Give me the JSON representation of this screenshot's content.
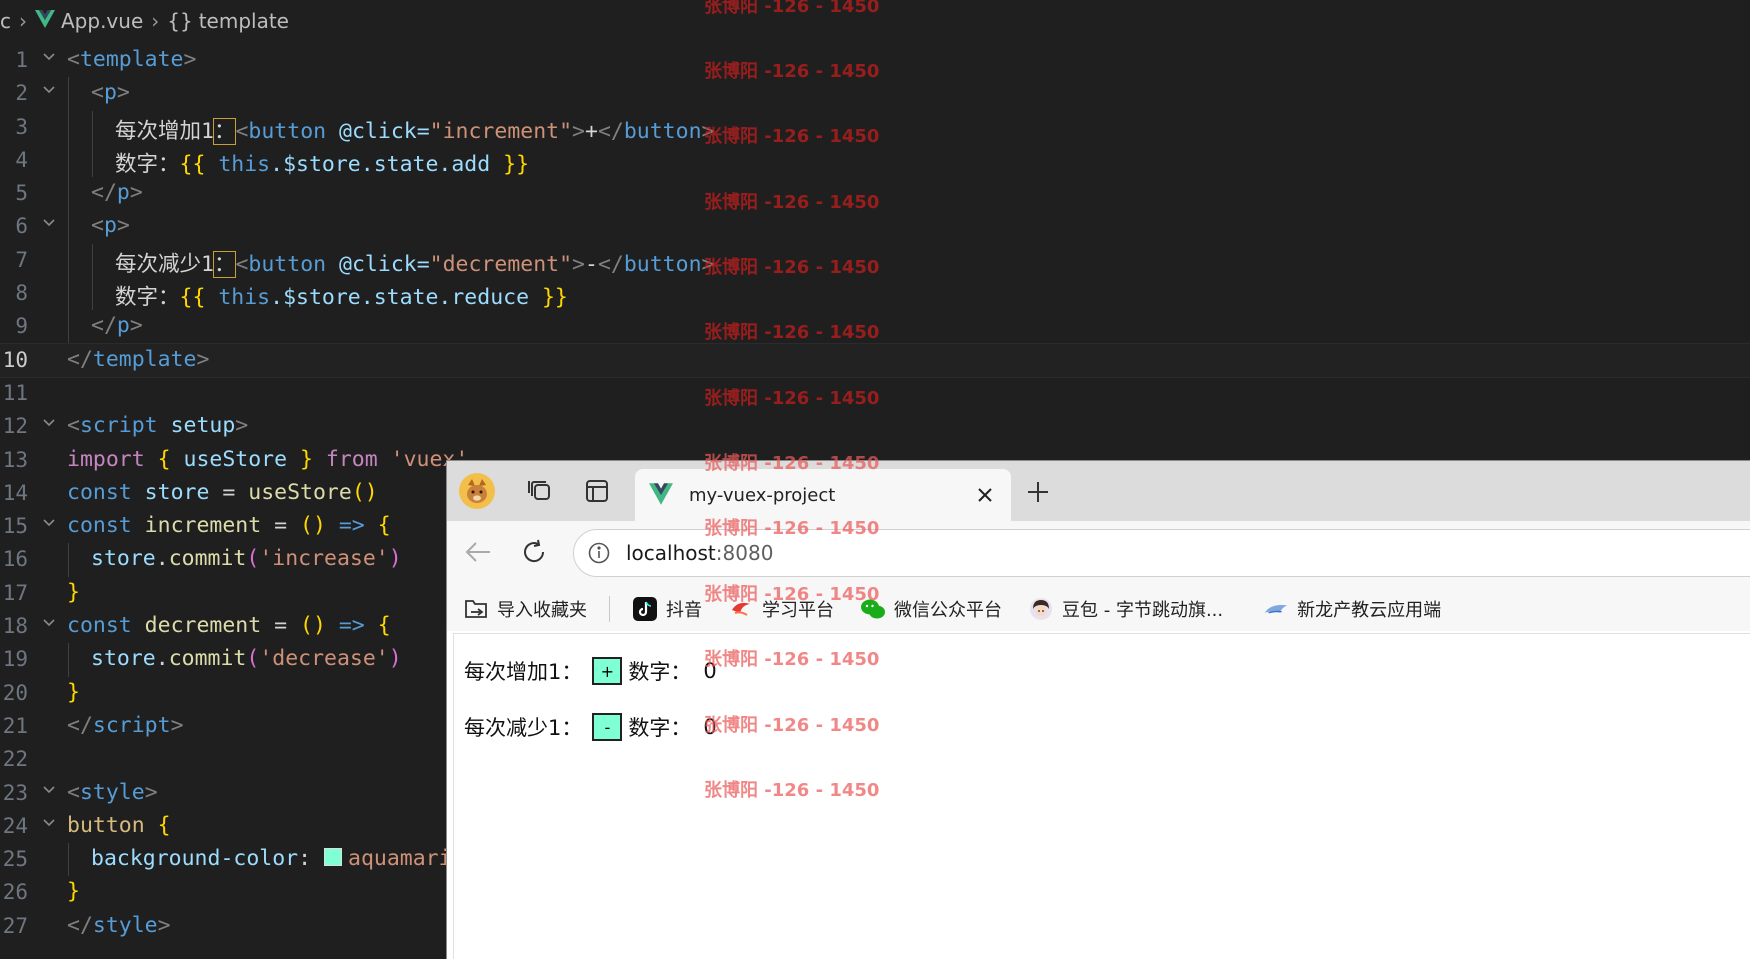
{
  "breadcrumb": {
    "folder": "c",
    "file": "App.vue",
    "symbol": "template"
  },
  "line_numbers": [
    "1",
    "2",
    "3",
    "4",
    "5",
    "6",
    "7",
    "8",
    "9",
    "10",
    "11",
    "12",
    "13",
    "14",
    "15",
    "16",
    "17",
    "18",
    "19",
    "20",
    "21",
    "22",
    "23",
    "24",
    "25",
    "26",
    "27"
  ],
  "code": {
    "l1": {
      "open": "<",
      "tag": "template",
      "close": ">"
    },
    "l2": {
      "open": "<",
      "tag": "p",
      "close": ">"
    },
    "l3": {
      "text": "每次增加1",
      "colon": "：",
      "open": "<",
      "tag": "button",
      "attr": " @click=",
      "str": "\"increment\"",
      "close": ">",
      "content": "+",
      "endopen": "</",
      "endtag": "button",
      "endclose": ">"
    },
    "l4": {
      "text": "数字：",
      "lb": "{{",
      "this": " this",
      "expr": ".$store.state.add ",
      "rb": "}}"
    },
    "l5": {
      "open": "</",
      "tag": "p",
      "close": ">"
    },
    "l6": {
      "open": "<",
      "tag": "p",
      "close": ">"
    },
    "l7": {
      "text": "每次减少1",
      "colon": "：",
      "open": "<",
      "tag": "button",
      "attr": " @click=",
      "str": "\"decrement\"",
      "close": ">",
      "content": "-",
      "endopen": "</",
      "endtag": "button",
      "endclose": ">"
    },
    "l8": {
      "text": "数字：",
      "lb": "{{",
      "this": " this",
      "expr": ".$store.state.reduce ",
      "rb": "}}"
    },
    "l9": {
      "open": "</",
      "tag": "p",
      "close": ">"
    },
    "l10": {
      "open": "</",
      "tag": "template",
      "close": ">"
    },
    "l12": {
      "open": "<",
      "tag": "script",
      "attr": " setup",
      "close": ">"
    },
    "l13": {
      "kw": "import",
      "lb": " {",
      "name": " useStore ",
      "rb": "}",
      "kw2": " from ",
      "str": "'vuex'"
    },
    "l14": {
      "kw": "const",
      "name": " store",
      "op": " = ",
      "fn": "useStore",
      "paren": "()"
    },
    "l15": {
      "kw": "const",
      "name": " increment",
      "op": " = ",
      "paren": "()",
      "arrow": " => ",
      "brace": "{"
    },
    "l16": {
      "obj": "store",
      "dot": ".",
      "fn": "commit",
      "lp": "(",
      "str": "'increase'",
      "rp": ")"
    },
    "l17": {
      "brace": "}"
    },
    "l18": {
      "kw": "const",
      "name": " decrement",
      "op": " = ",
      "paren": "()",
      "arrow": " => ",
      "brace": "{"
    },
    "l19": {
      "obj": "store",
      "dot": ".",
      "fn": "commit",
      "lp": "(",
      "str": "'decrease'",
      "rp": ")"
    },
    "l20": {
      "brace": "}"
    },
    "l21": {
      "open": "</",
      "tag": "script",
      "close": ">"
    },
    "l23": {
      "open": "<",
      "tag": "style",
      "close": ">"
    },
    "l24": {
      "sel": "button",
      "brace": " {"
    },
    "l25": {
      "prop": "background-color",
      "colon": ": ",
      "val": "aquamarine"
    },
    "l26": {
      "brace": "}"
    },
    "l27": {
      "open": "</",
      "tag": "style",
      "close": ">"
    }
  },
  "browser": {
    "tab_title": "my-vuex-project",
    "url_host": "localhost",
    "url_port": ":8080",
    "bookmarks": [
      "导入收藏夹",
      "抖音",
      "学习平台",
      "微信公众平台",
      "豆包 - 字节跳动旗...",
      "新龙产教云应用端"
    ],
    "page": {
      "row1_label": "每次增加1：",
      "row1_button": "+",
      "row1_count_label": "数字：",
      "row1_count": "0",
      "row2_label": "每次减少1：",
      "row2_button": "-",
      "row2_count_label": "数字：",
      "row2_count": "0"
    }
  },
  "watermark": "张博阳 -126 - 1450",
  "colors": {
    "button_bg": "#7fffd4",
    "editor_bg": "#1f1f1f",
    "tag": "#569cd6",
    "string": "#ce9178",
    "keyword": "#c586c0"
  }
}
